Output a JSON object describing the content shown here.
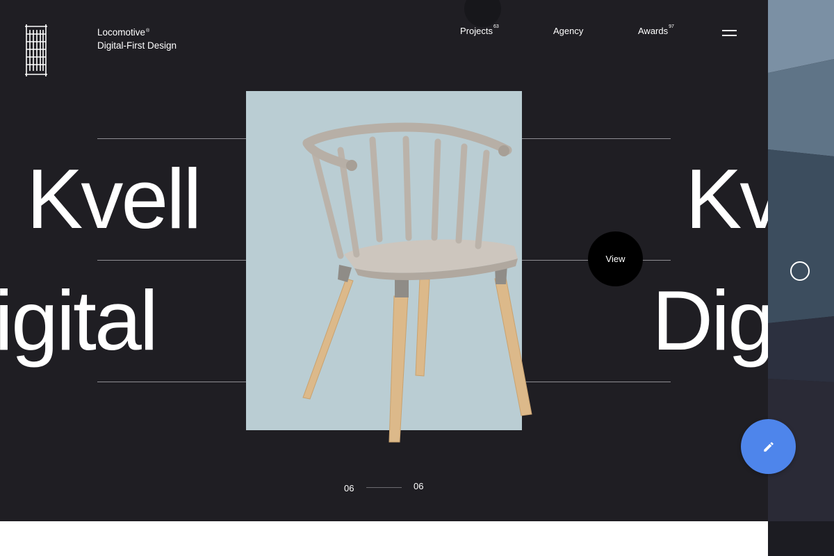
{
  "brand": {
    "name": "Locomotive",
    "name_mark": "®",
    "tagline": "Digital-First Design"
  },
  "nav": {
    "projects_label": "Projects",
    "projects_count": "63",
    "agency_label": "Agency",
    "awards_label": "Awards",
    "awards_count": "97"
  },
  "slide": {
    "word_top": "Kvell",
    "word_bottom": "Digital",
    "word_bottom_left_visible": "igital",
    "word_top_right_visible": "Kv",
    "word_bottom_right_visible": "Dig",
    "view_label": "View",
    "current_index": "06",
    "total": "06"
  },
  "icons": {
    "logo": "locomotive-logo",
    "menu": "hamburger-menu-icon",
    "edit": "pencil-icon",
    "side": "circle-icon"
  },
  "colors": {
    "background": "#1f1e23",
    "photo_bg": "#bacdd3",
    "view_button": "#000000",
    "edit_fab": "#4e85eb"
  }
}
